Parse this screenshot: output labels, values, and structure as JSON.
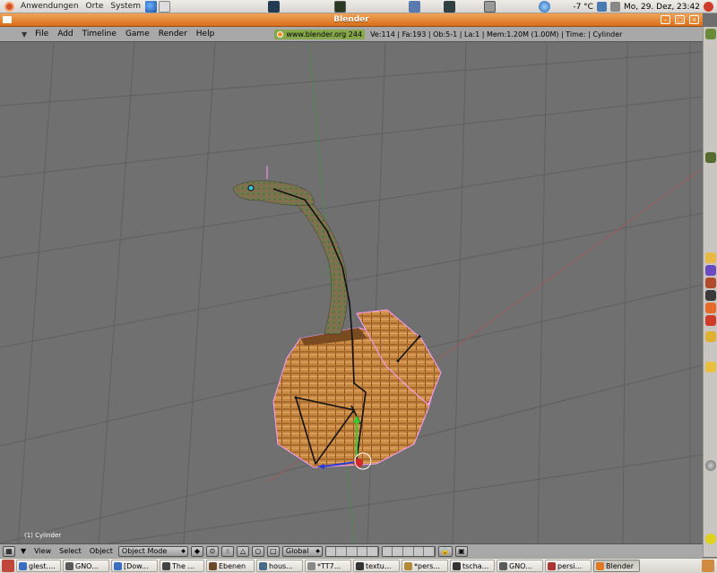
{
  "top_panel": {
    "menus": [
      "Anwendungen",
      "Orte",
      "System"
    ],
    "weather": "-7 °C",
    "clock": "Mo, 29. Dez, 23:42",
    "icons": [
      "ubuntu-logo-icon",
      "firefox-icon",
      "network-icon",
      "terminal-icon",
      "calculator-icon",
      "globe-icon",
      "volume-icon",
      "power-icon"
    ]
  },
  "window": {
    "title": "Blender"
  },
  "menu_bar": {
    "items": [
      "File",
      "Add",
      "Timeline",
      "Game",
      "Render",
      "Help"
    ],
    "website": "www.blender.org 244",
    "stats": "Ve:114 | Fa:193 | Ob:5-1 | La:1 | Mem:1.20M (1.00M) | Time: | Cylinder"
  },
  "viewport": {
    "object_label": "(1) Cylinder"
  },
  "header_3d": {
    "view": "View",
    "select": "Select",
    "object": "Object",
    "mode": "Object Mode",
    "orientation": "Global"
  },
  "taskbar": {
    "tasks": [
      {
        "label": "glest....",
        "color": "#3a6fc0"
      },
      {
        "label": "GNO...",
        "color": "#5a5a5a"
      },
      {
        "label": "[Dow...",
        "color": "#3a6fc0"
      },
      {
        "label": "The ...",
        "color": "#444"
      },
      {
        "label": "Ebenen",
        "color": "#6b4a2a"
      },
      {
        "label": "hous...",
        "color": "#4a6a8a"
      },
      {
        "label": "*TT7...",
        "color": "#888"
      },
      {
        "label": "textu...",
        "color": "#333"
      },
      {
        "label": "*pers...",
        "color": "#b08a3a"
      },
      {
        "label": "tscha...",
        "color": "#333"
      },
      {
        "label": "GNO...",
        "color": "#5a5a5a"
      },
      {
        "label": "persi...",
        "color": "#a33"
      },
      {
        "label": "Blender",
        "color": "#e07a20"
      }
    ]
  },
  "colors": {
    "title_orange": "#e07a20",
    "viewport_bg": "#707070",
    "header_gray": "#a8a8a8",
    "selection_pink": "#ff9cff"
  }
}
